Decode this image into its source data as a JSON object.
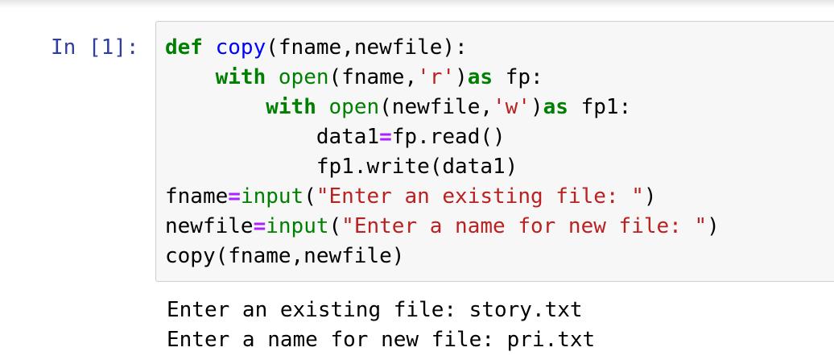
{
  "cell": {
    "prompt": "In [1]:",
    "code": {
      "line1": {
        "kw_def": "def",
        "fn_name": "copy",
        "rest": "(fname,newfile):"
      },
      "line2": {
        "indent": "    ",
        "kw_with": "with",
        "sp": " ",
        "bi_open": "open",
        "p1": "(fname,",
        "str": "'r'",
        "p2": ")",
        "kw_as": "as",
        "rest": " fp:"
      },
      "line3": {
        "indent": "        ",
        "kw_with": "with",
        "sp": " ",
        "bi_open": "open",
        "p1": "(newfile,",
        "str": "'w'",
        "p2": ")",
        "kw_as": "as",
        "rest": " fp1:"
      },
      "line4": {
        "indent": "            ",
        "lhs": "data1",
        "op": "=",
        "rhs": "fp.read()"
      },
      "line5": {
        "indent": "            ",
        "text": "fp1.write(data1)"
      },
      "line6": {
        "lhs": "fname",
        "op": "=",
        "bi_input": "input",
        "p1": "(",
        "str": "\"Enter an existing file: \"",
        "p2": ")"
      },
      "line7": {
        "lhs": "newfile",
        "op": "=",
        "bi_input": "input",
        "p1": "(",
        "str": "\"Enter a name for new file: \"",
        "p2": ")"
      },
      "line8": {
        "text": "copy(fname,newfile)"
      }
    },
    "output": [
      "Enter an existing file: story.txt",
      "Enter a name for new file: pri.txt"
    ]
  }
}
